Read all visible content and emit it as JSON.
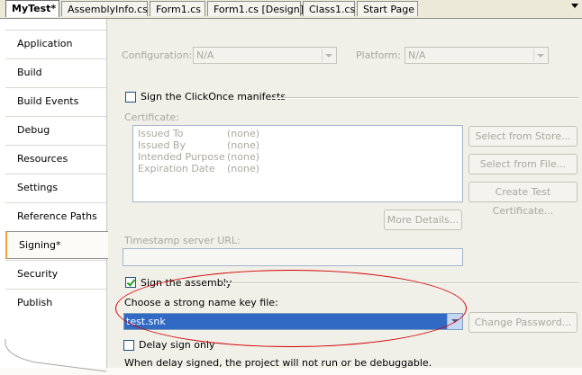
{
  "tabs": [
    {
      "label": "MyTest*",
      "active": true
    },
    {
      "label": "AssemblyInfo.cs"
    },
    {
      "label": "Form1.cs"
    },
    {
      "label": "Form1.cs [Design]"
    },
    {
      "label": "Class1.cs"
    },
    {
      "label": "Start Page"
    }
  ],
  "nav": [
    {
      "label": "Application"
    },
    {
      "label": "Build"
    },
    {
      "label": "Build Events"
    },
    {
      "label": "Debug"
    },
    {
      "label": "Resources"
    },
    {
      "label": "Settings"
    },
    {
      "label": "Reference Paths"
    },
    {
      "label": "Signing*",
      "selected": true
    },
    {
      "label": "Security"
    },
    {
      "label": "Publish"
    }
  ],
  "config": {
    "label": "Configuration:",
    "value": "N/A"
  },
  "platform": {
    "label": "Platform:",
    "value": "N/A"
  },
  "clickonce": {
    "label": "Sign the ClickOnce manifests",
    "checked": false
  },
  "certificate": {
    "label": "Certificate:",
    "rows": [
      {
        "key": "Issued To",
        "value": "(none)"
      },
      {
        "key": "Issued By",
        "value": "(none)"
      },
      {
        "key": "Intended Purpose",
        "value": "(none)"
      },
      {
        "key": "Expiration Date",
        "value": "(none)"
      }
    ]
  },
  "buttons": {
    "select_store": "Select from Store...",
    "select_file": "Select from File...",
    "create_test": "Create Test Certificate...",
    "more_details": "More Details...",
    "change_password": "Change Password..."
  },
  "timestamp": {
    "label": "Timestamp server URL:",
    "value": ""
  },
  "sign_assembly": {
    "label": "Sign the assembly",
    "checked": true
  },
  "key_file": {
    "label": "Choose a strong name key file:",
    "value": "test.snk"
  },
  "delay_sign": {
    "label": "Delay sign only",
    "checked": false
  },
  "delay_note": "When delay signed, the project will not run or be debuggable.",
  "colors": {
    "highlight": "#316ac5",
    "annotation": "#d40000",
    "nav_accent": "#f2a33a"
  }
}
